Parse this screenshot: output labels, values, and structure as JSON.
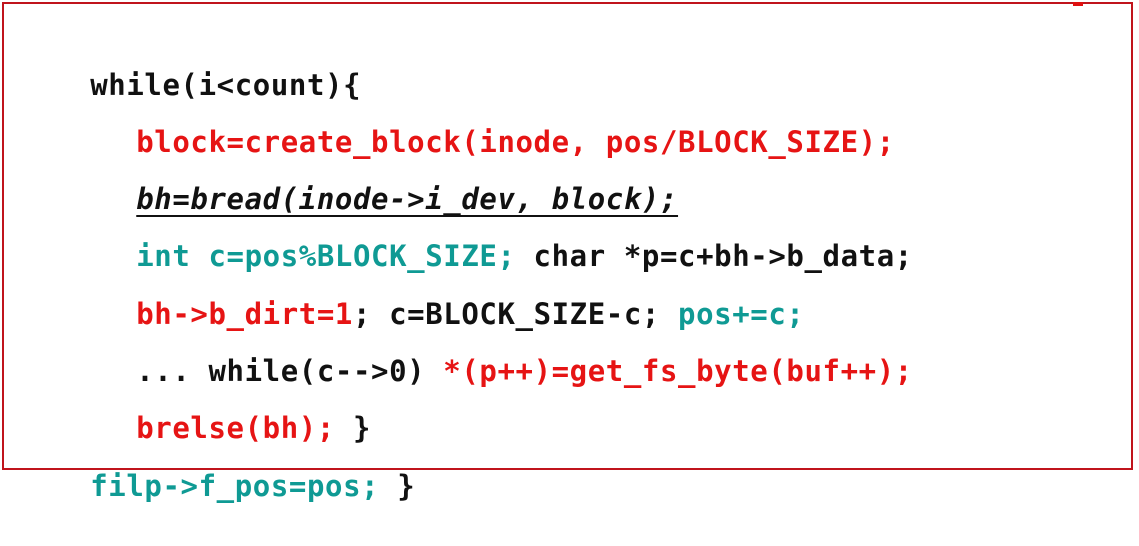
{
  "code": {
    "line1": {
      "a": "while(i<count){"
    },
    "line2": {
      "a": "block=create_block(inode, pos/BLOCK_SIZE);"
    },
    "line3": {
      "a": "bh=bread(inode->i_dev, block);"
    },
    "line4": {
      "a": "int c=pos%BLOCK_SIZE;",
      "b": " char *p=c+bh->b_data;"
    },
    "line5": {
      "a": "bh->b_dirt=1",
      "b": "; c=BLOCK_SIZE-c; ",
      "c": "pos+=c;"
    },
    "line6": {
      "a": "... while(c-->0) ",
      "b": "*(p++)=get_fs_byte(buf++);"
    },
    "line7": {
      "a": "brelse(bh);",
      "b": " }"
    },
    "line8": {
      "a": "filp->f_pos=pos;",
      "b": " }"
    }
  },
  "colors": {
    "border": "#c0141c",
    "red": "#e61414",
    "teal": "#0f9a94",
    "black": "#111111"
  }
}
